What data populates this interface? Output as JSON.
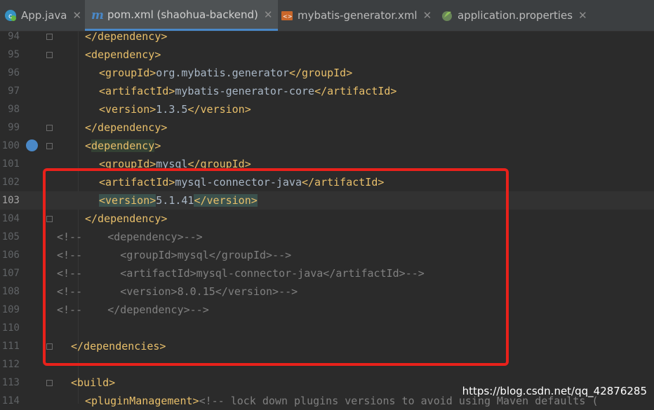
{
  "tabs": [
    {
      "label": "App.java",
      "icon": "java-class-icon",
      "active": false
    },
    {
      "label": "pom.xml (shaohua-backend)",
      "icon": "maven-icon",
      "active": true
    },
    {
      "label": "mybatis-generator.xml",
      "icon": "xml-file-icon",
      "active": false
    },
    {
      "label": "application.properties",
      "icon": "spring-properties-icon",
      "active": false
    }
  ],
  "lines": [
    {
      "num": "94",
      "tokens": [
        [
          "tag",
          "</dependency>"
        ]
      ]
    },
    {
      "num": "95",
      "tokens": [
        [
          "tag",
          "<dependency>"
        ]
      ]
    },
    {
      "num": "96",
      "tokens": [
        [
          "tag",
          "<groupId>"
        ],
        [
          "txt",
          "org.mybatis.generator"
        ],
        [
          "tag",
          "</groupId>"
        ]
      ]
    },
    {
      "num": "97",
      "tokens": [
        [
          "tag",
          "<artifactId>"
        ],
        [
          "txt",
          "mybatis-generator-core"
        ],
        [
          "tag",
          "</artifactId>"
        ]
      ]
    },
    {
      "num": "98",
      "tokens": [
        [
          "tag",
          "<version>"
        ],
        [
          "txt",
          "1.3.5"
        ],
        [
          "tag",
          "</version>"
        ]
      ]
    },
    {
      "num": "99",
      "tokens": [
        [
          "tag",
          "</dependency>"
        ]
      ]
    },
    {
      "num": "100",
      "tokens": [
        [
          "tag",
          "<"
        ],
        [
          "tag hl2",
          "dependency"
        ],
        [
          "tag",
          ">"
        ]
      ]
    },
    {
      "num": "101",
      "tokens": [
        [
          "tag",
          "<groupId>"
        ],
        [
          "txt",
          "mysql"
        ],
        [
          "tag",
          "</groupId>"
        ]
      ]
    },
    {
      "num": "102",
      "tokens": [
        [
          "tag",
          "<artifactId>"
        ],
        [
          "txt",
          "mysql-connector-java"
        ],
        [
          "tag",
          "</artifactId>"
        ]
      ]
    },
    {
      "num": "103",
      "tokens": [
        [
          "tag hl",
          "<version>"
        ],
        [
          "txt",
          "5.1.41"
        ],
        [
          "tag hl",
          "</version>"
        ]
      ]
    },
    {
      "num": "104",
      "tokens": [
        [
          "tag",
          "</dependency>"
        ]
      ]
    },
    {
      "num": "105",
      "tokens": [
        [
          "cmt",
          "<!--    <dependency>-->"
        ]
      ]
    },
    {
      "num": "106",
      "tokens": [
        [
          "cmt",
          "<!--      <groupId>mysql</groupId>-->"
        ]
      ]
    },
    {
      "num": "107",
      "tokens": [
        [
          "cmt",
          "<!--      <artifactId>mysql-connector-java</artifactId>-->"
        ]
      ]
    },
    {
      "num": "108",
      "tokens": [
        [
          "cmt",
          "<!--      <version>8.0.15</version>-->"
        ]
      ]
    },
    {
      "num": "109",
      "tokens": [
        [
          "cmt",
          "<!--    </dependency>-->"
        ]
      ]
    },
    {
      "num": "110",
      "tokens": []
    },
    {
      "num": "111",
      "tokens": [
        [
          "tag",
          "</dependencies>"
        ]
      ]
    },
    {
      "num": "112",
      "tokens": []
    },
    {
      "num": "113",
      "tokens": [
        [
          "tag",
          "<build>"
        ]
      ]
    },
    {
      "num": "114",
      "tokens": [
        [
          "tag",
          "<pluginManagement>"
        ],
        [
          "cmt",
          "<!-- lock down plugins versions to avoid using Maven defaults ("
        ]
      ]
    }
  ],
  "current_line": "103",
  "watermark": "https://blog.csdn.net/qq_42876285",
  "colors": {
    "tag": "#e8bf6a",
    "text": "#a9b7c6",
    "comment": "#808080",
    "highlight_box": "#e8211b",
    "background": "#2b2b2b"
  }
}
